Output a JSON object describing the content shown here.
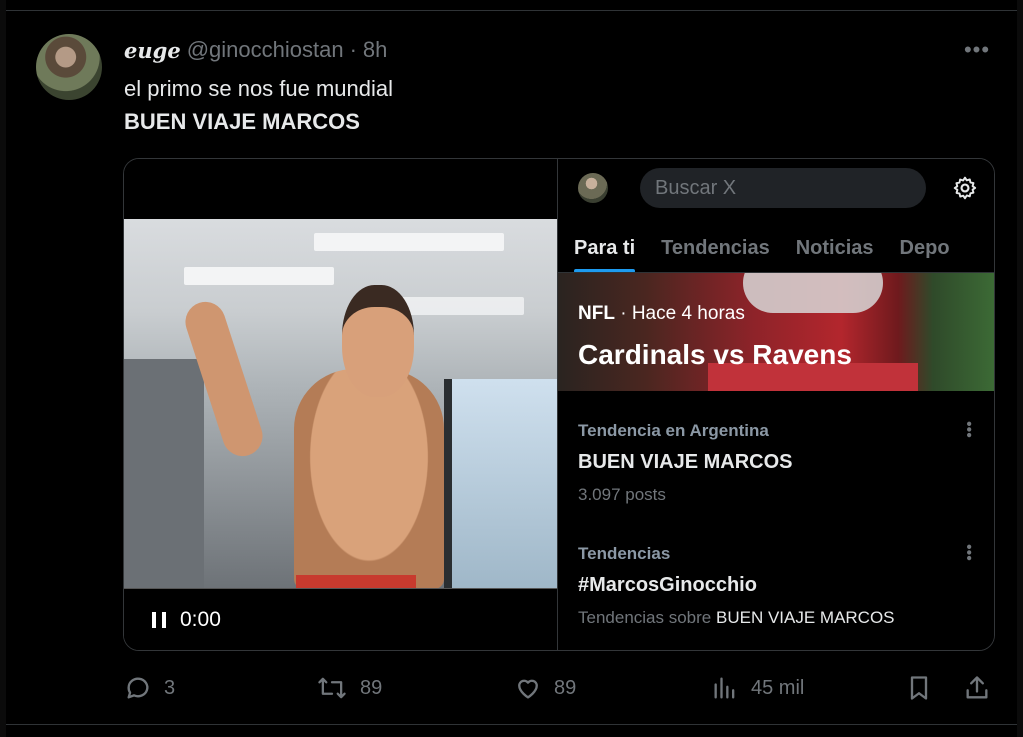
{
  "tweet": {
    "display_name": "euge",
    "handle": "@ginocchiostan",
    "separator": "·",
    "time": "8h",
    "more_label": "•••",
    "text_line1": "el primo se nos fue mundial",
    "text_line2": "BUEN VIAJE MARCOS"
  },
  "video": {
    "timecode": "0:00",
    "state": "playing"
  },
  "embedded_screenshot": {
    "search_placeholder": "Buscar X",
    "tabs": [
      {
        "label": "Para ti",
        "active": true
      },
      {
        "label": "Tendencias",
        "active": false
      },
      {
        "label": "Noticias",
        "active": false
      },
      {
        "label": "Depo",
        "active": false
      }
    ],
    "hero": {
      "category": "NFL",
      "separator": "·",
      "time": "Hace 4 horas",
      "title": "Cardinals vs Ravens"
    },
    "trends": [
      {
        "category": "Tendencia en Argentina",
        "name": "BUEN VIAJE MARCOS",
        "sub": "3.097 posts"
      },
      {
        "category": "Tendencias",
        "name": "#MarcosGinocchio",
        "sub_prefix": "Tendencias sobre ",
        "sub_highlight": "BUEN VIAJE MARCOS"
      }
    ]
  },
  "actions": {
    "replies": "3",
    "reposts": "89",
    "likes": "89",
    "views": "45 mil"
  },
  "colors": {
    "background": "#000000",
    "text_primary": "#e7e9ea",
    "text_secondary": "#71767b",
    "accent": "#1d9bf0",
    "border": "#2f3336"
  }
}
